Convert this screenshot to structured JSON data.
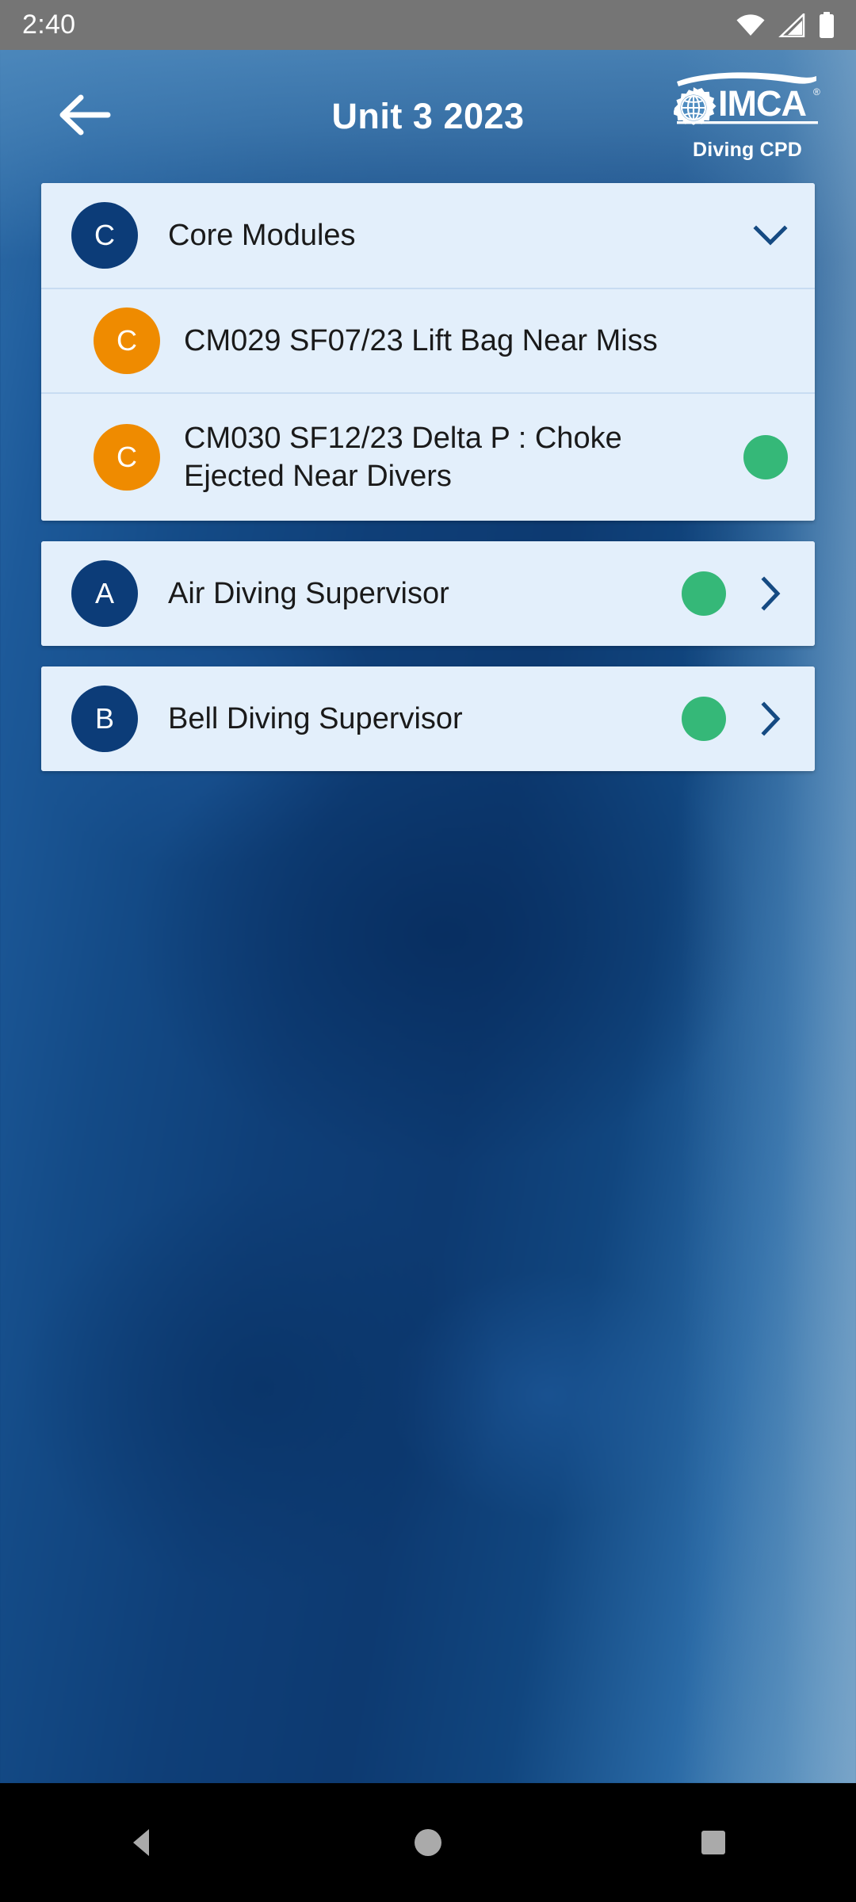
{
  "status_bar": {
    "time": "2:40",
    "icons": [
      "wifi-icon",
      "cellular-signal-icon",
      "battery-icon"
    ]
  },
  "header": {
    "back_label": "back-arrow",
    "title": "Unit 3 2023",
    "logo_name": "IMCA",
    "logo_subtitle": "Diving CPD"
  },
  "colors": {
    "avatar_navy": "#0c3c78",
    "avatar_orange": "#ef8b00",
    "status_green": "#35b878",
    "card_background": "#e3effb",
    "chevron_navy": "#154a82",
    "status_bar": "#757575"
  },
  "groups": [
    {
      "name": "core-modules-group",
      "rows": [
        {
          "avatar_letter": "C",
          "avatar_color": "navy",
          "label": "Core Modules",
          "has_status_dot": false,
          "trailing_icon": "chevron-down-icon",
          "indented": false
        },
        {
          "avatar_letter": "C",
          "avatar_color": "orange",
          "label": "CM029 SF07/23 Lift Bag Near Miss",
          "has_status_dot": false,
          "trailing_icon": "none",
          "indented": true
        },
        {
          "avatar_letter": "C",
          "avatar_color": "orange",
          "label": "CM030 SF12/23 Delta P : Choke Ejected Near Divers",
          "has_status_dot": true,
          "trailing_icon": "none",
          "indented": true
        }
      ]
    },
    {
      "name": "air-diving-supervisor-group",
      "rows": [
        {
          "avatar_letter": "A",
          "avatar_color": "navy",
          "label": "Air Diving Supervisor",
          "has_status_dot": true,
          "trailing_icon": "chevron-right-icon",
          "indented": false
        }
      ]
    },
    {
      "name": "bell-diving-supervisor-group",
      "rows": [
        {
          "avatar_letter": "B",
          "avatar_color": "navy",
          "label": "Bell Diving Supervisor",
          "has_status_dot": true,
          "trailing_icon": "chevron-right-icon",
          "indented": false
        }
      ]
    }
  ],
  "nav_bar": {
    "back": "back-triangle-icon",
    "home": "home-circle-icon",
    "recents": "recents-square-icon"
  }
}
